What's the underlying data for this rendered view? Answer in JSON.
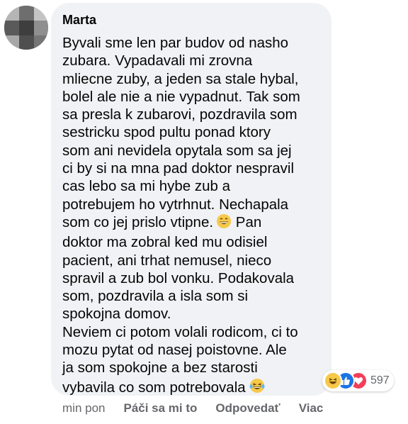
{
  "comment": {
    "author": "Marta",
    "lines": [
      "Byvali sme len par budov od nasho",
      "zubara. Vypadavali mi zrovna",
      "mliecne zuby, a jeden sa stale hybal,",
      "bolel ale nie a nie vypadnut. Tak som",
      "sa presla k zubarovi, pozdravila som",
      "sestricku spod pultu ponad ktory",
      "som ani nevidela opytala som sa jej",
      "ci by si na mna pad doktor nespravil",
      "cas lebo sa mi hybe zub a",
      "potrebujem ho vytrhnut. Nechapala",
      "som co jej prislo vtipne.",
      "doktor ma zobral ked mu odisiel",
      "pacient, ani trhat nemusel, nieco",
      "spravil a zub bol vonku. Podakovala",
      "som, pozdravila a isla som si",
      "spokojna domov.",
      "Neviem ci potom volali rodicom, ci to",
      "mozu pytat od nasej poistovne. Ale",
      "ja som spokojne a bez starosti",
      "vybavila co som potrebovala"
    ],
    "line11_after_emoji": "Pan",
    "emoji_grin": "grinning-face-emoji",
    "emoji_laugh": "tears-of-joy-emoji"
  },
  "reactions": {
    "icons": [
      "haha-reaction-icon",
      "like-reaction-icon",
      "love-reaction-icon"
    ],
    "count": "597"
  },
  "actions": {
    "time": "min pon",
    "like": "Páči sa mi to",
    "reply": "Odpovedať",
    "more": "Viac"
  },
  "colors": {
    "bubble": "#f0f2f5",
    "text": "#050505",
    "secondary": "#65676b",
    "like_blue": "#1b74e4",
    "love_red": "#f33e58",
    "haha_yellow": "#f7c94a"
  }
}
